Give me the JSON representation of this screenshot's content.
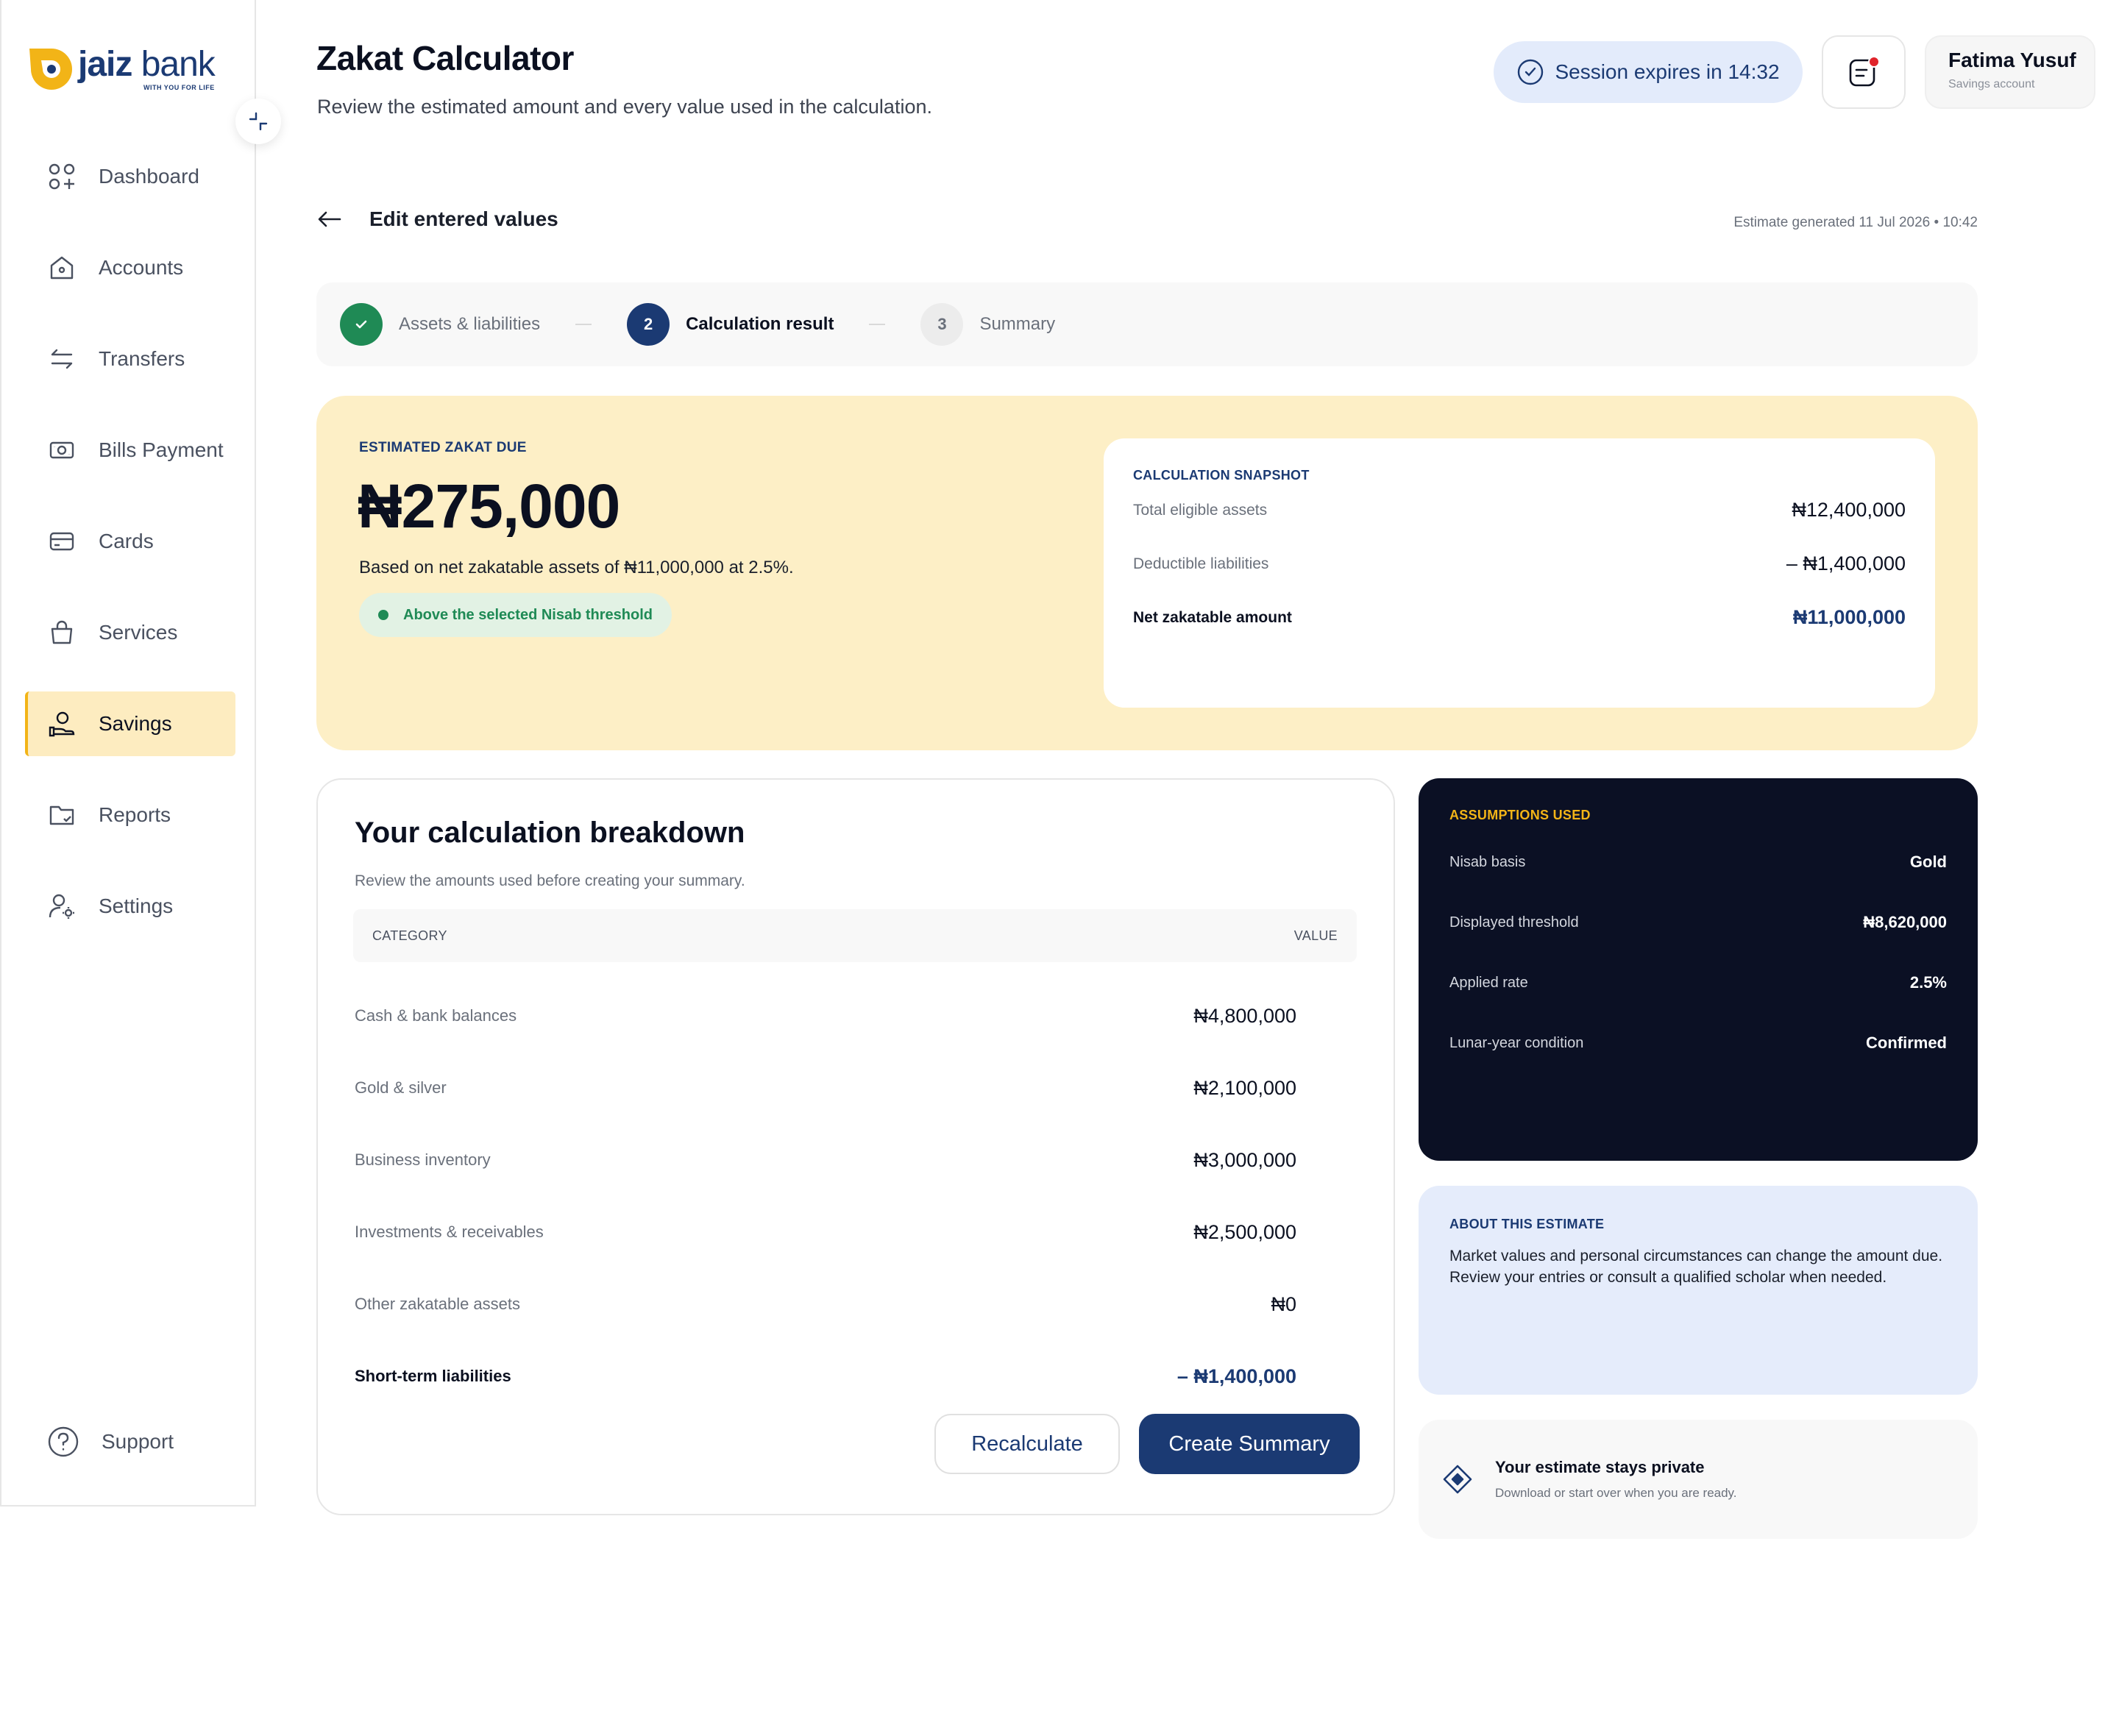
{
  "brand": {
    "name_bold": "jaiz",
    "name_light": "bank",
    "tagline": "WITH YOU FOR LIFE",
    "accent": "#f2b417",
    "primary": "#1b3a73"
  },
  "sidebar": {
    "items": [
      {
        "label": "Dashboard",
        "icon": "dashboard-icon"
      },
      {
        "label": "Accounts",
        "icon": "home-icon"
      },
      {
        "label": "Transfers",
        "icon": "transfer-icon"
      },
      {
        "label": "Bills Payment",
        "icon": "bill-icon"
      },
      {
        "label": "Cards",
        "icon": "card-icon"
      },
      {
        "label": "Services",
        "icon": "bag-icon"
      },
      {
        "label": "Savings",
        "icon": "savings-icon",
        "active": true
      },
      {
        "label": "Reports",
        "icon": "folder-icon"
      },
      {
        "label": "Settings",
        "icon": "user-settings-icon"
      }
    ],
    "support_label": "Support"
  },
  "header": {
    "title": "Zakat Calculator",
    "subtitle": "Review the estimated amount and every value used in the calculation.",
    "session": "Session expires in 14:32",
    "user_name": "Fatima Yusuf",
    "user_role": "Savings account"
  },
  "back": {
    "label": "Edit entered values",
    "generated": "Estimate generated 11 Jul 2026 • 10:42"
  },
  "stepper": {
    "steps": [
      {
        "label": "Assets & liabilities",
        "state": "done"
      },
      {
        "number": "2",
        "label": "Calculation result",
        "state": "current"
      },
      {
        "number": "3",
        "label": "Summary",
        "state": "todo"
      }
    ]
  },
  "hero": {
    "label": "ESTIMATED ZAKAT DUE",
    "amount": "₦275,000",
    "description": "Based on net zakatable assets of ₦11,000,000 at 2.5%.",
    "badge": "Above the selected Nisab threshold"
  },
  "snapshot": {
    "label": "CALCULATION SNAPSHOT",
    "rows": [
      {
        "label": "Total eligible assets",
        "value": "₦12,400,000"
      },
      {
        "label": "Deductible liabilities",
        "value": "– ₦1,400,000"
      },
      {
        "label": "Net zakatable amount",
        "value": "₦11,000,000"
      }
    ]
  },
  "breakdown": {
    "title": "Your calculation breakdown",
    "subtitle": "Review the amounts used before creating your summary.",
    "columns": [
      "CATEGORY",
      "VALUE"
    ],
    "rows": [
      {
        "label": "Cash & bank balances",
        "value": "₦4,800,000"
      },
      {
        "label": "Gold & silver",
        "value": "₦2,100,000"
      },
      {
        "label": "Business inventory",
        "value": "₦3,000,000"
      },
      {
        "label": "Investments & receivables",
        "value": "₦2,500,000"
      },
      {
        "label": "Other zakatable assets",
        "value": "₦0"
      },
      {
        "label": "Short-term liabilities",
        "value": "– ₦1,400,000"
      }
    ],
    "recalc_label": "Recalculate",
    "create_label": "Create Summary"
  },
  "assumptions": {
    "label": "ASSUMPTIONS USED",
    "rows": [
      {
        "label": "Nisab basis",
        "value": "Gold"
      },
      {
        "label": "Displayed threshold",
        "value": "₦8,620,000"
      },
      {
        "label": "Applied rate",
        "value": "2.5%"
      },
      {
        "label": "Lunar-year condition",
        "value": "Confirmed"
      }
    ]
  },
  "about": {
    "label": "ABOUT THIS ESTIMATE",
    "text": "Market values and personal circumstances can change the amount due. Review your entries or consult a qualified scholar when needed."
  },
  "privacy": {
    "title": "Your estimate stays private",
    "subtitle": "Download or start over when you are ready."
  }
}
